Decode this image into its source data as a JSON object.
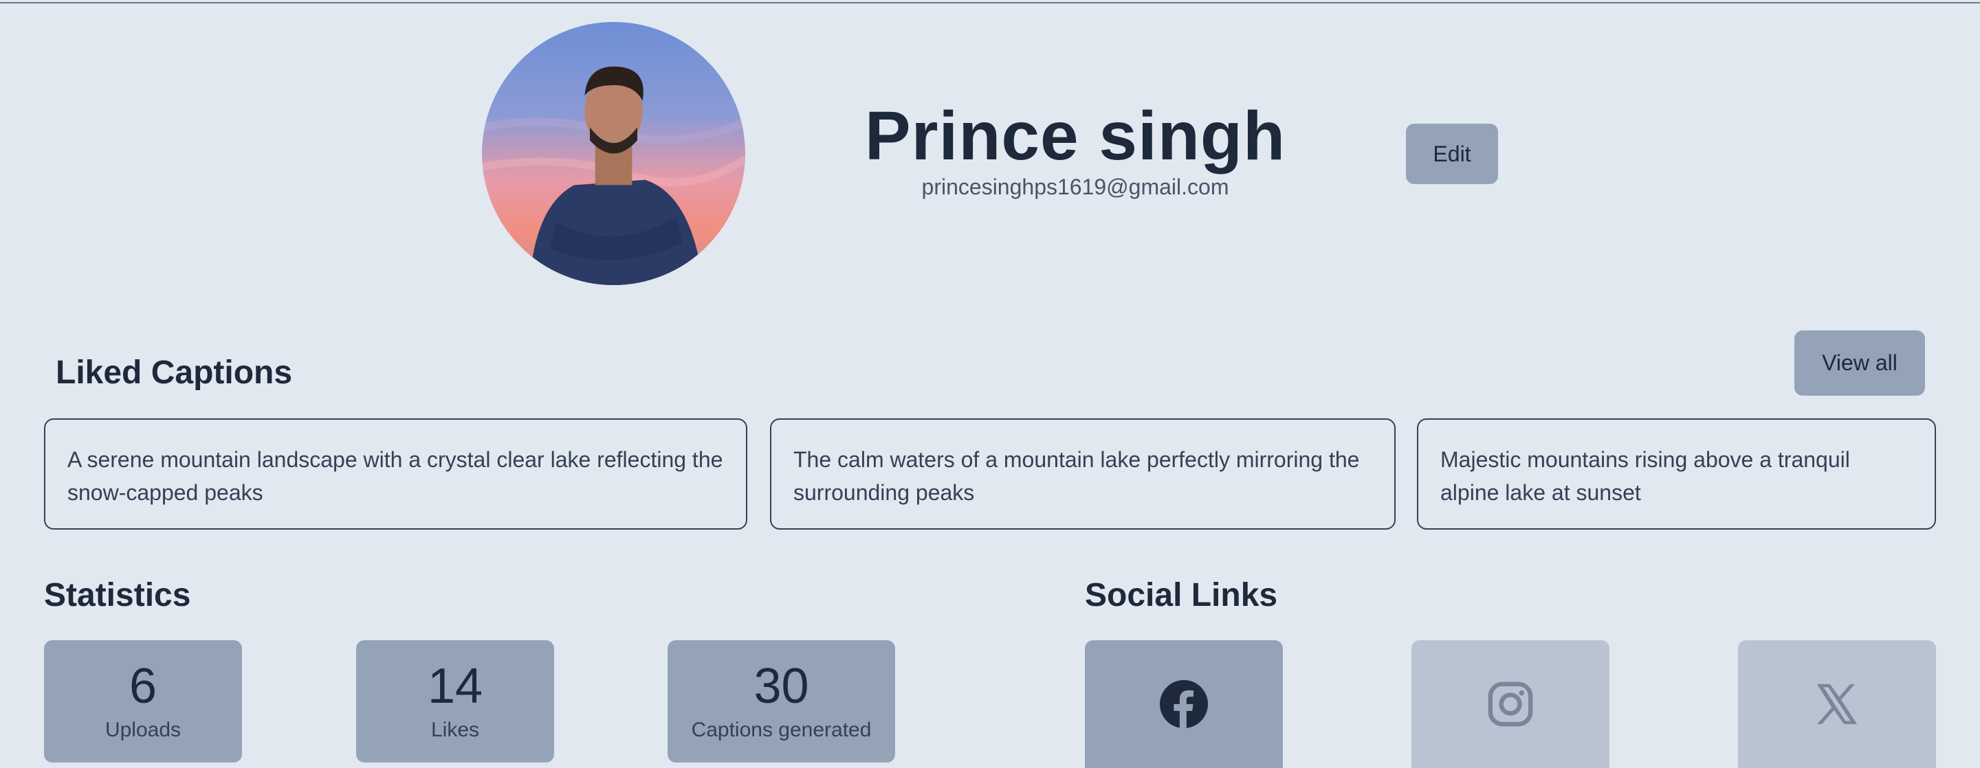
{
  "profile": {
    "name": "Prince singh",
    "email": "princesinghps1619@gmail.com",
    "edit_label": "Edit"
  },
  "liked_captions": {
    "title": "Liked Captions",
    "view_all_label": "View all",
    "items": [
      "A serene mountain landscape with a crystal clear lake reflecting the snow-capped peaks",
      "The calm waters of a mountain lake perfectly mirroring the surrounding peaks",
      "Majestic mountains rising above a tranquil alpine lake at sunset"
    ]
  },
  "statistics": {
    "title": "Statistics",
    "items": [
      {
        "value": "6",
        "label": "Uploads"
      },
      {
        "value": "14",
        "label": "Likes"
      },
      {
        "value": "30",
        "label": "Captions generated"
      }
    ]
  },
  "social": {
    "title": "Social Links",
    "links": [
      {
        "icon": "facebook-icon",
        "active": true
      },
      {
        "icon": "instagram-icon",
        "active": false
      },
      {
        "icon": "x-twitter-icon",
        "active": false
      }
    ]
  },
  "colors": {
    "background": "#e2e8f0",
    "button": "#94a3b8",
    "text": "#1e293b",
    "inactive_social": "#b9c3d1"
  }
}
